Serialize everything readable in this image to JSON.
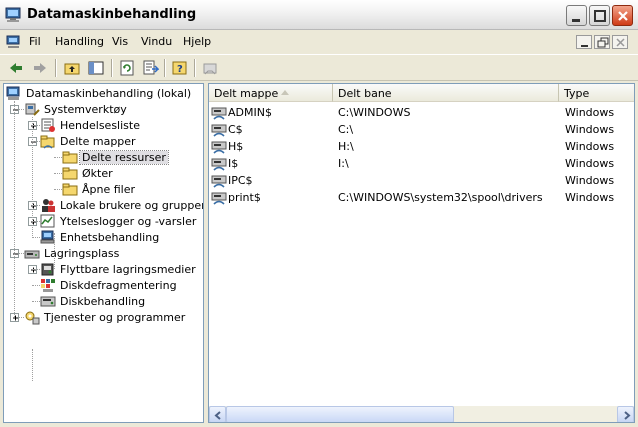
{
  "window": {
    "title": "Datamaskinbehandling"
  },
  "menu": {
    "items": [
      "Fil",
      "Handling",
      "Vis",
      "Vindu",
      "Hjelp"
    ]
  },
  "tree": {
    "root": "Datamaskinbehandling (lokal)",
    "nodes": [
      {
        "label": "Systemverktøy",
        "level": 1,
        "expander": "minus",
        "icon": "tools-icon"
      },
      {
        "label": "Hendelsesliste",
        "level": 2,
        "expander": "plus",
        "icon": "event-viewer-icon"
      },
      {
        "label": "Delte mapper",
        "level": 2,
        "expander": "minus",
        "icon": "shared-folders-icon"
      },
      {
        "label": "Delte ressurser",
        "level": 3,
        "expander": "",
        "icon": "folder-icon",
        "selected": true
      },
      {
        "label": "Økter",
        "level": 3,
        "expander": "",
        "icon": "folder-icon"
      },
      {
        "label": "Åpne filer",
        "level": 3,
        "expander": "",
        "icon": "folder-icon"
      },
      {
        "label": "Lokale brukere og grupper",
        "level": 2,
        "expander": "plus",
        "icon": "users-icon"
      },
      {
        "label": "Ytelseslogger og -varsler",
        "level": 2,
        "expander": "plus",
        "icon": "performance-icon"
      },
      {
        "label": "Enhetsbehandling",
        "level": 2,
        "expander": "",
        "icon": "device-manager-icon"
      },
      {
        "label": "Lagringsplass",
        "level": 1,
        "expander": "minus",
        "icon": "storage-icon"
      },
      {
        "label": "Flyttbare lagringsmedier",
        "level": 2,
        "expander": "plus",
        "icon": "removable-storage-icon"
      },
      {
        "label": "Diskdefragmentering",
        "level": 2,
        "expander": "",
        "icon": "defrag-icon"
      },
      {
        "label": "Diskbehandling",
        "level": 2,
        "expander": "",
        "icon": "disk-management-icon"
      },
      {
        "label": "Tjenester og programmer",
        "level": 1,
        "expander": "plus",
        "icon": "services-icon"
      }
    ]
  },
  "list": {
    "columns": [
      "Delt mappe",
      "Delt bane",
      "Type"
    ],
    "rows": [
      {
        "name": "ADMIN$",
        "path": "C:\\WINDOWS",
        "type": "Windows"
      },
      {
        "name": "C$",
        "path": "C:\\",
        "type": "Windows"
      },
      {
        "name": "H$",
        "path": "H:\\",
        "type": "Windows"
      },
      {
        "name": "I$",
        "path": "I:\\",
        "type": "Windows"
      },
      {
        "name": "IPC$",
        "path": "",
        "type": "Windows"
      },
      {
        "name": "print$",
        "path": "C:\\WINDOWS\\system32\\spool\\drivers",
        "type": "Windows"
      }
    ]
  },
  "colors": {
    "selection": "#e0dfe3",
    "pane_border": "#7f9db9",
    "chrome": "#ece9d8"
  }
}
